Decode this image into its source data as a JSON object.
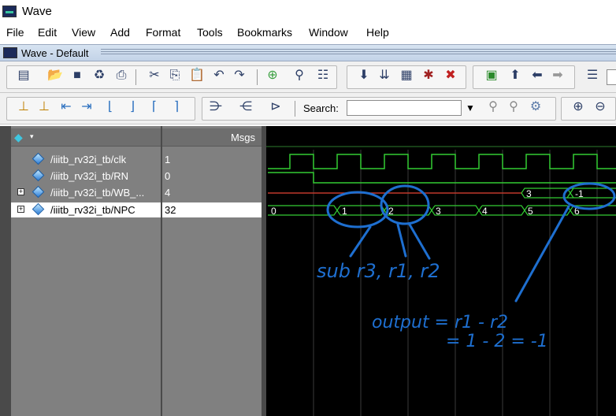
{
  "window": {
    "title": "Wave"
  },
  "menu": [
    "File",
    "Edit",
    "View",
    "Add",
    "Format",
    "Tools",
    "Bookmarks",
    "Window",
    "Help"
  ],
  "subwindow": {
    "title": "Wave - Default"
  },
  "search": {
    "label": "Search:",
    "value": ""
  },
  "pane_headers": {
    "msgs": "Msgs"
  },
  "signals": [
    {
      "name": "/iiitb_rv32i_tb/clk",
      "value": "1",
      "expandable": false,
      "selected": false
    },
    {
      "name": "/iiitb_rv32i_tb/RN",
      "value": "0",
      "expandable": false,
      "selected": false
    },
    {
      "name": "/iiitb_rv32i_tb/WB_...",
      "value": "4",
      "expandable": true,
      "selected": false
    },
    {
      "name": "/iiitb_rv32i_tb/NPC",
      "value": "32",
      "expandable": true,
      "selected": true
    }
  ],
  "wave": {
    "wb_labels": [
      "3",
      "-1"
    ],
    "npc_labels": [
      "0",
      "1",
      "2",
      "3",
      "4",
      "5",
      "6"
    ]
  },
  "annotations": {
    "instruction": "sub r3, r1, r2",
    "output": "output = r1 - r2",
    "result": "= 1 - 2 = -1"
  },
  "colors": {
    "wave_green": "#33cc33",
    "wave_red": "#c0392b",
    "annotation_blue": "#1e6fd0"
  }
}
